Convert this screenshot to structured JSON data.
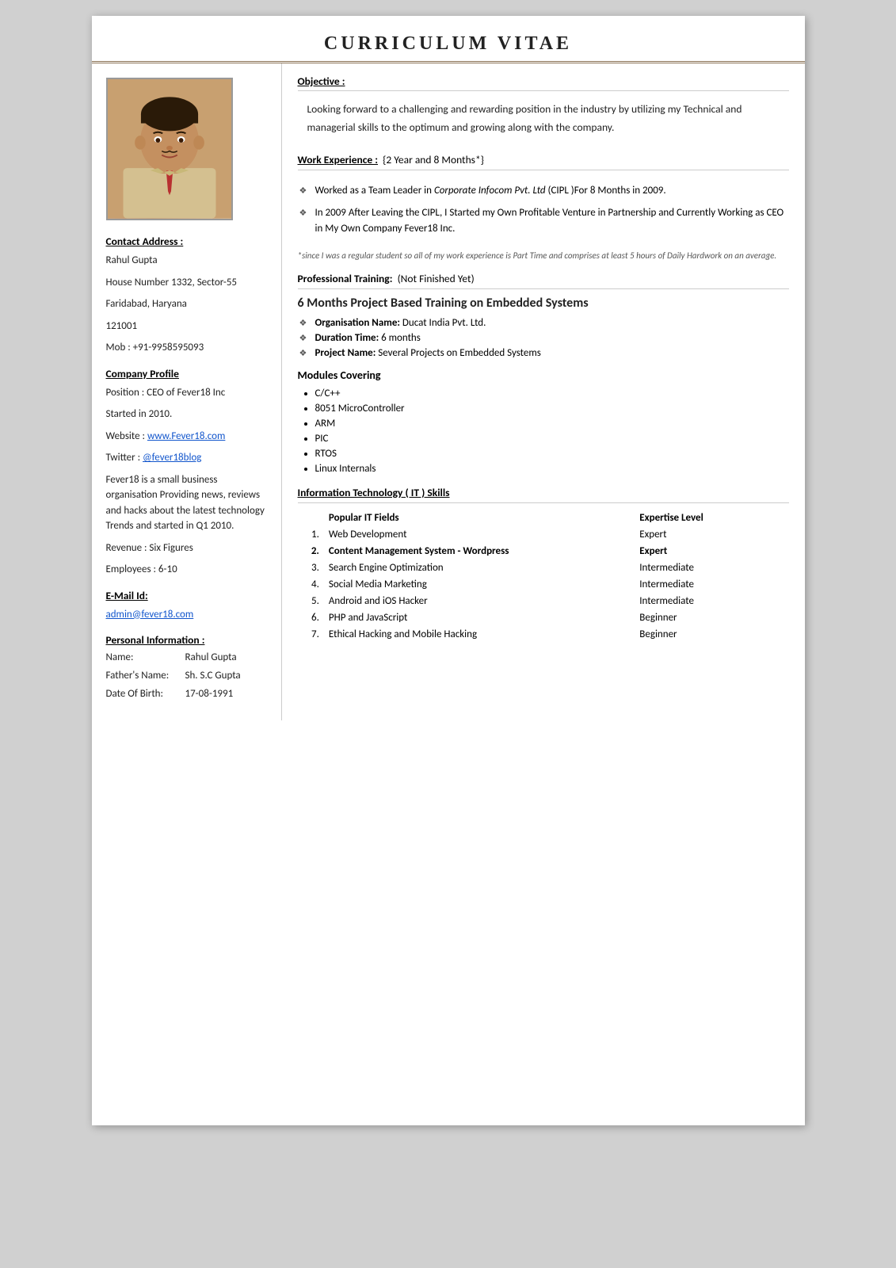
{
  "header": {
    "title": "CURRICULUM VITAE"
  },
  "left": {
    "contact_label": "Contact  Address :",
    "name": "Rahul Gupta",
    "address1": "House Number 1332, Sector-55",
    "address2": "Faridabad, Haryana",
    "pincode": "121001",
    "mobile": "Mob : +91-9958595093",
    "company_label": "Company  Profile",
    "position": "Position : CEO of Fever18 Inc",
    "started": "Started in 2010.",
    "website_prefix": "Website : ",
    "website_text": "www.Fever18.com",
    "website_url": "http://www.Fever18.com",
    "twitter_prefix": "Twitter : ",
    "twitter_text": "@fever18blog",
    "twitter_url": "#",
    "company_desc": "Fever18 is a small business organisation Providing news, reviews and hacks about the latest technology Trends and started in Q1 2010.",
    "revenue": "Revenue : Six Figures",
    "employees": "Employees : 6-10",
    "email_label": "E-Mail Id:",
    "email_text": "admin@fever18.com",
    "email_url": "mailto:admin@fever18.com",
    "personal_label": "Personal   Information :",
    "p_name_label": "Name:",
    "p_name_value": "Rahul Gupta",
    "p_father_label": "Father's Name:",
    "p_father_value": "Sh. S.C Gupta",
    "p_dob_label": "Date Of Birth:",
    "p_dob_value": "17-08-1991"
  },
  "right": {
    "objective_label": "Objective :",
    "objective_text": "Looking forward to a challenging and rewarding position in the industry by utilizing my Technical and managerial skills to the optimum and growing along with the company.",
    "work_label": "Work Experience :",
    "work_duration": "{2 Year and 8 Months*}",
    "work_items": [
      "Worked as a Team Leader in Corporate Infocom Pvt. Ltd (CIPL )For 8 Months in 2009.",
      "In 2009 After Leaving the CIPL, I Started my Own Profitable Venture in Partnership and Currently Working as CEO in My Own Company Fever18 Inc."
    ],
    "work_footnote": "*since  I was a regular student so all of my work experience is Part Time and comprises at least 5 hours of Daily Hardwork on an average.",
    "training_label": "Professional Training:",
    "training_status": "(Not Finished Yet)",
    "training_title": "6 Months Project Based Training on Embedded Systems",
    "training_items": [
      {
        "label": "Organisation Name:",
        "value": "Ducat India Pvt. Ltd."
      },
      {
        "label": "Duration Time:",
        "value": "6 months"
      },
      {
        "label": "Project Name:",
        "value": "Several Projects on Embedded Systems"
      }
    ],
    "modules_title": "Modules Covering",
    "modules": [
      "C/C++",
      "8051 MicroController",
      "ARM",
      "PIC",
      "RTOS",
      "Linux Internals"
    ],
    "it_skills_label": "Information Technology  ( IT ) Skills",
    "skills_col1": "Popular IT Fields",
    "skills_col2": "Expertise Level",
    "skills": [
      {
        "num": "1.",
        "field": "Web Development",
        "level": "Expert"
      },
      {
        "num": "2.",
        "field": "Content Management System  - Wordpress",
        "level": "Expert",
        "bold": true
      },
      {
        "num": "3.",
        "field": "Search Engine Optimization",
        "level": "Intermediate"
      },
      {
        "num": "4.",
        "field": "Social Media Marketing",
        "level": "Intermediate"
      },
      {
        "num": "5.",
        "field": "Android and iOS Hacker",
        "level": "Intermediate"
      },
      {
        "num": "6.",
        "field": "PHP and JavaScript",
        "level": "Beginner"
      },
      {
        "num": "7.",
        "field": "Ethical Hacking and Mobile Hacking",
        "level": "Beginner"
      }
    ]
  }
}
